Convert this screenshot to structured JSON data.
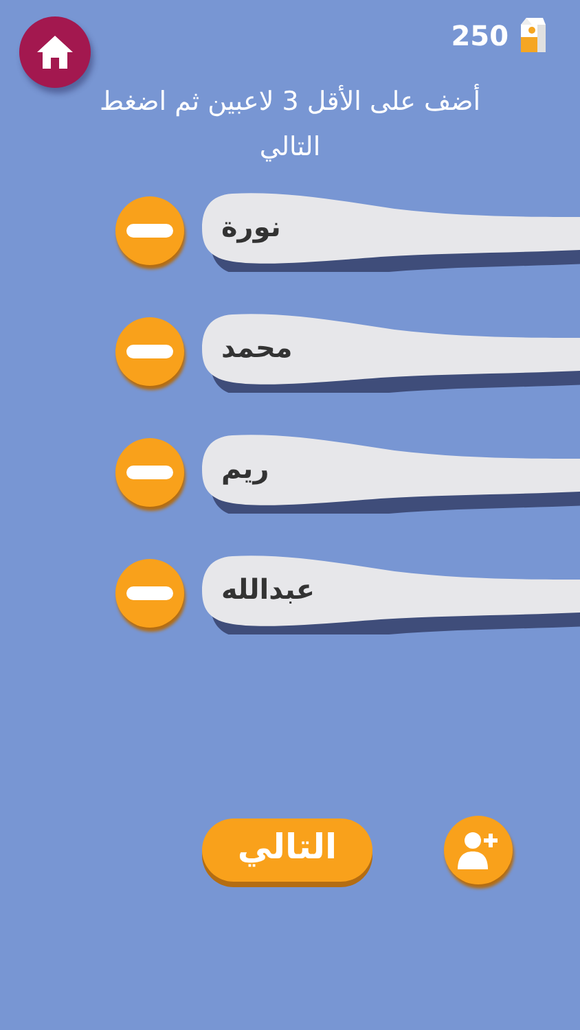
{
  "coins": "250",
  "instruction": "أضف على الأقل 3 لاعبين ثم اضغط التالي",
  "players": [
    {
      "name": "نورة"
    },
    {
      "name": "محمد"
    },
    {
      "name": "ريم"
    },
    {
      "name": "عبدالله"
    }
  ],
  "next_button": "التالي"
}
